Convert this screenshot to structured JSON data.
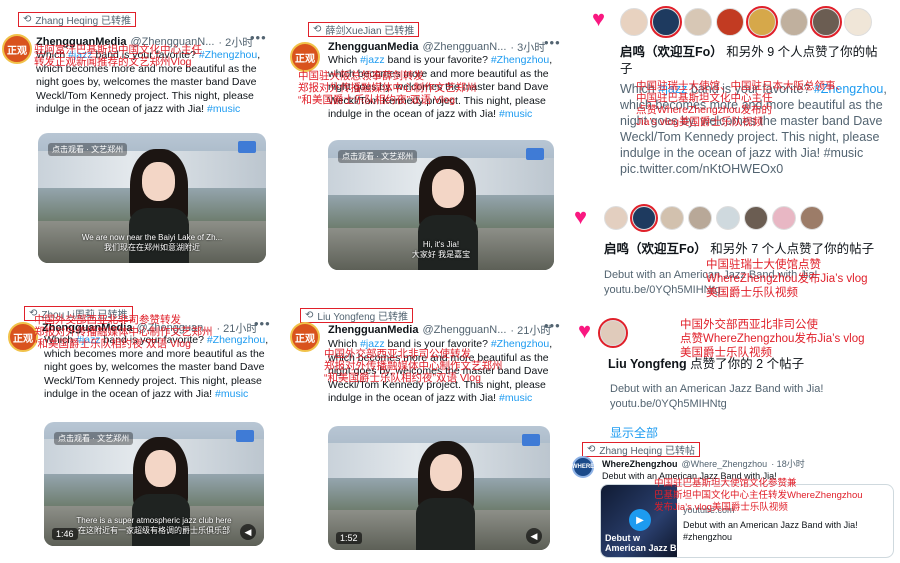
{
  "common": {
    "tweet_body_1": "Which ",
    "tweet_hashtag_jazz": "#jazz",
    "tweet_body_2": " band is your favorite?",
    "tweet_hashtag_zhengzhou": "#Zhengzhou",
    "tweet_body_3": ", which becomes more and more beautiful as the night goes by, welcomes the master band Dave Weckl/Tom Kennedy project. This night, please indulge in the ocean of jazz with Jia! ",
    "tweet_hashtag_music": "#music",
    "more_icon": "more-horizontal-icon",
    "retweet_icon": "retweet-icon"
  },
  "tweets": [
    {
      "retweeter": "Zhang Heqing 已转推",
      "author": "ZhengguanMedia",
      "handle": "@ZhengguanN...",
      "time": "· 2小时",
      "avatar_text": "正观",
      "annotation": "驻阿富汗巴基斯坦中国文化中心主任\n转发正观新闻推荐的文艺郑州Vlog",
      "caption": "We are now near the Baiyi Lake of Zh...\n我们现在在郑州如意湖附近",
      "duration": "",
      "play_label": "点击观看 · 文艺郑州"
    },
    {
      "retweeter": "薛剑XueJian 已转推",
      "author": "ZhengguanMedia",
      "handle": "@ZhengguanN...",
      "time": "· 3小时",
      "avatar_text": "正观",
      "annotation": "中国驻大阪总领事薛剑转发\n郑报对外传播融媒体中心制作文艺郑州\n“和美国爵士乐队相约夜”双语 Vlog",
      "caption": "Hi, it's Jia!\n大家好 我是嘉宝",
      "duration": "",
      "play_label": "点击观看 · 文艺郑州"
    },
    {
      "retweeter": "Zhou Li周莉 已转推",
      "author": "ZhengguanMedia",
      "handle": "@Zhengguan...",
      "time": "· 21小时",
      "avatar_text": "正观",
      "annotation": "中国外交部西亚北非司参赞转发\n郑报对外传播融媒体中心制作文艺郑州\n“和美国爵士乐队相约夜”双语 Vlog",
      "caption": "There is a super atmospheric jazz club here\n在这附近有一家超级有格调的爵士乐俱乐部",
      "duration": "1:46",
      "play_label": "点击观看 · 文艺郑州"
    },
    {
      "retweeter": "Liu Yongfeng 已转推",
      "author": "ZhengguanMedia",
      "handle": "@ZhengguanN...",
      "time": "· 21小时",
      "avatar_text": "正观",
      "annotation": "中国外交部西亚北非司公使转发\n郑报对外传播融媒体中心制作文艺郑州\n“和美国爵士乐队相约夜”双语 Vlog",
      "caption": "",
      "duration": "1:52",
      "play_label": ""
    }
  ],
  "notifications": {
    "n1": {
      "heart_icon": "heart-icon",
      "actor": "启鸣（欢迎互Fo）",
      "text": " 和另外 9 个人点赞了你的帖子",
      "annotation": "中国驻瑞士大使馆、中国驻日本大阪总领事、\n中国驻巴基斯坦文化中心主任\n点赞WhereZhengzhou发布的\nJia’s vlog美国爵士乐队视频",
      "body_1": "Which ",
      "body_jazz": "#jazz",
      "body_2": " band is your favorite?\n",
      "body_zz": "#Zhengzhou",
      "body_3": ", which becomes more and more beautiful as the night goes by, welcomes the master band Dave Weckl/Tom Kennedy project. This night, please indulge in the ocean of jazz with Jia! #music pic.twitter.com/nKtOHWEOx0"
    },
    "n2": {
      "actor": "启鸣（欢迎互Fo）",
      "text": " 和另外 7 个人点赞了你的帖子",
      "annotation": "中国驻瑞士大使馆点赞\nWhereZhengzhou发布Jia’s vlog\n美国爵士乐队视频",
      "body": "Debut with an American Jazz Band with Jia!\nyoutu.be/0YQh5MIHNtg"
    },
    "n3": {
      "actor": "Liu Yongfeng",
      "text": " 点赞了你的 2 个帖子",
      "annotation": "中国外交部西亚北非司公使\n点赞WhereZhengzhou发布Jia’s vlog\n美国爵士乐队视频",
      "body": "Debut with an American Jazz Band with Jia!\nyoutu.be/0YQh5MIHNtg",
      "show_all": "显示全部"
    },
    "n4": {
      "retweeter": "Zhang Heqing 已转帖",
      "author": "WhereZhengzhou",
      "handle": "@Where_Zhengzhou",
      "time": "· 18小时",
      "avatar_text": "WHERE",
      "text": "Debut with an American Jazz Band with Jia!",
      "annotation": "中国驻巴基斯坦大使馆文化参赞兼\n巴基斯坦中国文化中心主任转发WhereZhengzhou\n发布Jia’s vlog美国爵士乐队视频",
      "card_source": "youtube.com",
      "card_title": "Debut with an American Jazz Band with Jia!\n#zhengzhou",
      "thumb_text": "Debut w\nAmerican Jazz B",
      "play_icon": "play-icon"
    }
  }
}
